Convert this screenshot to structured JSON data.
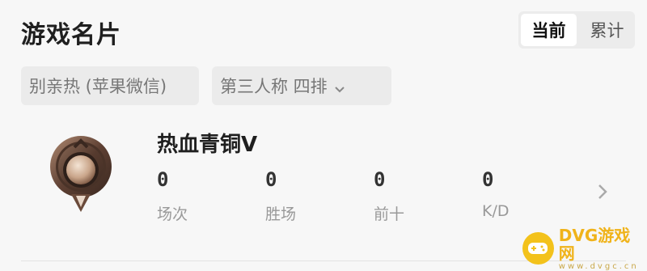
{
  "header": {
    "title": "游戏名片"
  },
  "toggle": {
    "current": "当前",
    "cumulative": "累计",
    "selected": "当前"
  },
  "filters": {
    "account": "别亲热 (苹果微信)",
    "mode": "第三人称  四排"
  },
  "rank": {
    "name": "热血青铜Ⅴ"
  },
  "stats": [
    {
      "value": "0",
      "label": "场次"
    },
    {
      "value": "0",
      "label": "胜场"
    },
    {
      "value": "0",
      "label": "前十"
    },
    {
      "value": "0",
      "label": "K/D"
    }
  ],
  "icons": {
    "badge": "bronze-rank-badge-icon",
    "chevron": "chevron-down-icon",
    "arrow": "chevron-right-icon"
  },
  "colors": {
    "accent": "#f3c21b",
    "bg": "#f7f7f7",
    "chip": "#ebebeb"
  },
  "watermark": {
    "brand": "DVG游戏网",
    "domain": "www.dvgc.cn"
  }
}
